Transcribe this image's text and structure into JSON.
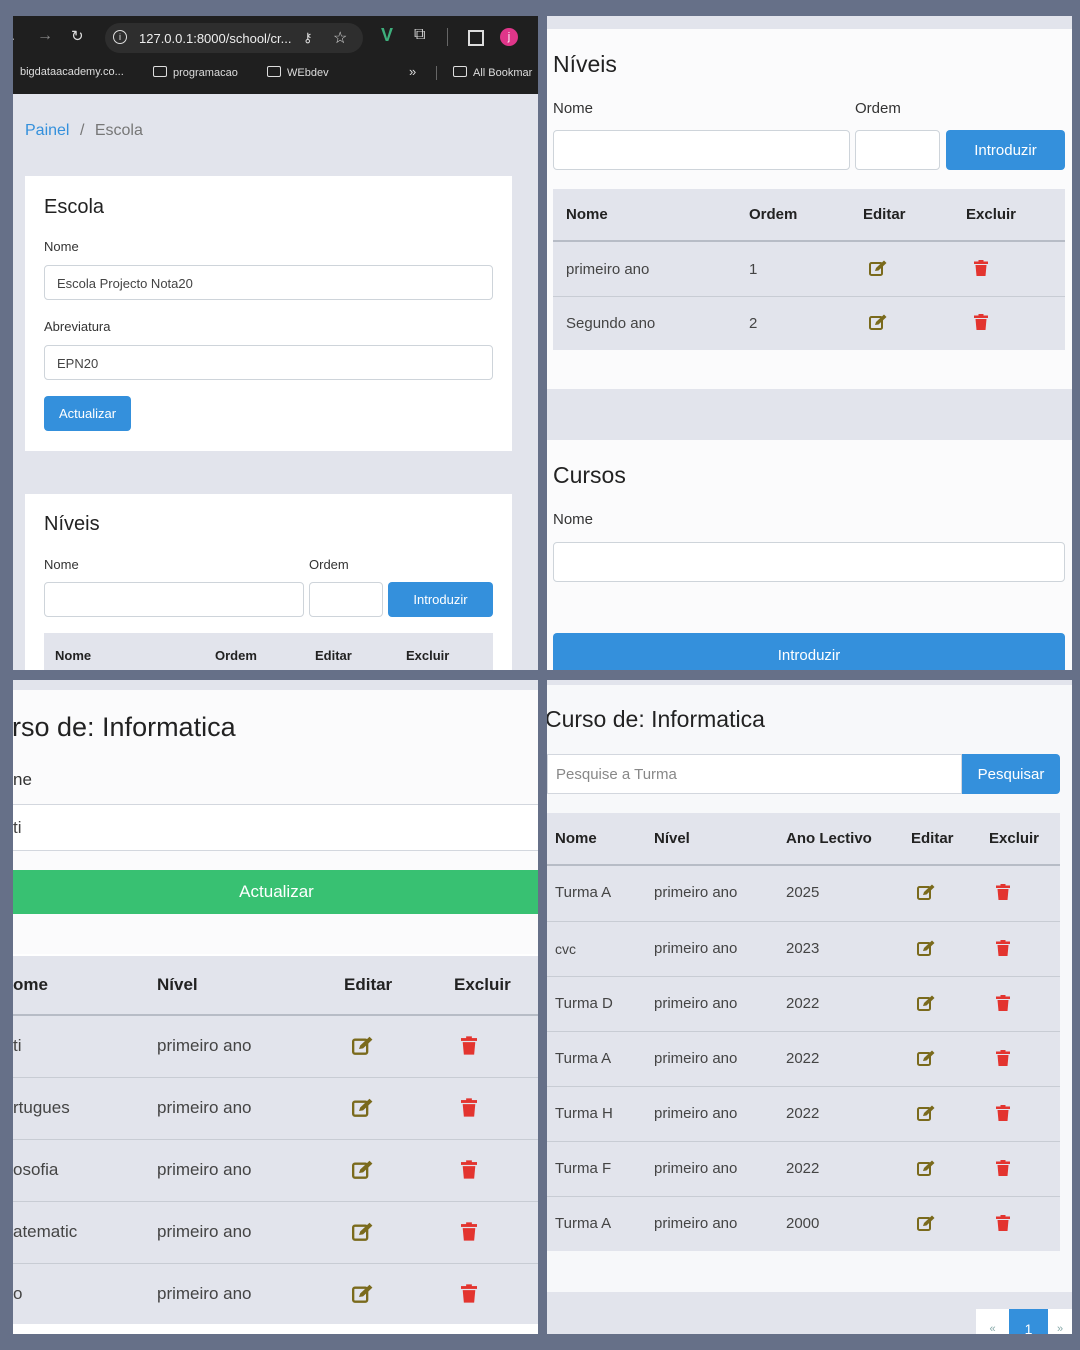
{
  "browser": {
    "url": "127.0.0.1:8000/school/cr...",
    "avatar_letter": "j",
    "bookmarks": [
      "bigdataacademy.co...",
      "programacao",
      "WEbdev",
      "»",
      "All Bookmar"
    ]
  },
  "breadcrumb": {
    "home": "Painel",
    "separator": "/",
    "current": "Escola"
  },
  "escola": {
    "title": "Escola",
    "nome_label": "Nome",
    "nome_value": "Escola Projecto Nota20",
    "abreviatura_label": "Abreviatura",
    "abreviatura_value": "EPN20",
    "update_button": "Actualizar"
  },
  "niveis": {
    "title": "Níveis",
    "nome_label": "Nome",
    "ordem_label": "Ordem",
    "add_button": "Introduzir",
    "headers": [
      "Nome",
      "Ordem",
      "Editar",
      "Excluir"
    ],
    "rows": [
      {
        "nome": "primeiro ano",
        "ordem": "1"
      },
      {
        "nome": "Segundo ano",
        "ordem": "2"
      }
    ]
  },
  "cursos": {
    "title": "Cursos",
    "nome_label": "Nome",
    "add_button": "Introduzir"
  },
  "curso_detail": {
    "title": "rso de: Informatica",
    "label_fragment": "ne",
    "value_fragment": "ti",
    "update_button": "Actualizar",
    "headers": [
      "ome",
      "Nível",
      "Editar",
      "Excluir"
    ],
    "rows": [
      {
        "nome": "ti",
        "nivel": "primeiro ano"
      },
      {
        "nome": "rtugues",
        "nivel": "primeiro ano"
      },
      {
        "nome": "osofia",
        "nivel": "primeiro ano"
      },
      {
        "nome": "atematic",
        "nivel": "primeiro ano"
      },
      {
        "nome": "o",
        "nivel": "primeiro ano"
      }
    ]
  },
  "turmas": {
    "title": "Curso de: Informatica",
    "search_placeholder": "Pesquise a Turma",
    "search_button": "Pesquisar",
    "headers": [
      "Nome",
      "Nível",
      "Ano Lectivo",
      "Editar",
      "Excluir"
    ],
    "rows": [
      {
        "nome": "Turma A",
        "nivel": "primeiro ano",
        "ano": "2025"
      },
      {
        "nome": "cvc",
        "nivel": "primeiro ano",
        "ano": "2023"
      },
      {
        "nome": "Turma D",
        "nivel": "primeiro ano",
        "ano": "2022"
      },
      {
        "nome": "Turma A",
        "nivel": "primeiro ano",
        "ano": "2022"
      },
      {
        "nome": "Turma H",
        "nivel": "primeiro ano",
        "ano": "2022"
      },
      {
        "nome": "Turma F",
        "nivel": "primeiro ano",
        "ano": "2022"
      },
      {
        "nome": "Turma A",
        "nivel": "primeiro ano",
        "ano": "2000"
      }
    ],
    "pagination": {
      "prev": "«",
      "current": "1",
      "next": "»"
    }
  },
  "colors": {
    "primary": "#3490dc",
    "success": "#38c172",
    "edit_icon": "#7a6a1c",
    "delete_icon": "#e3342f"
  }
}
